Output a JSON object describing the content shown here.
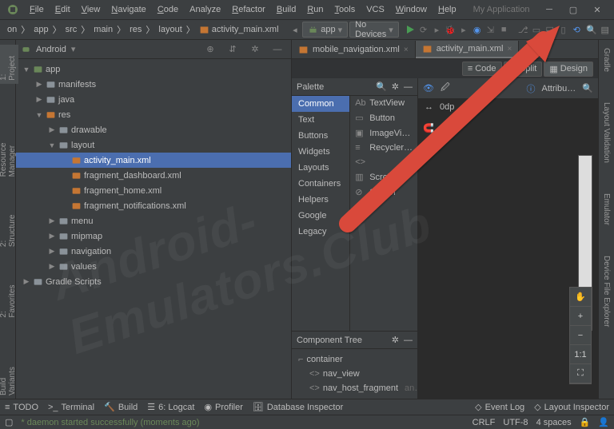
{
  "title_app": "My Application",
  "menu": [
    "File",
    "Edit",
    "View",
    "Navigate",
    "Code",
    "Analyze",
    "Refactor",
    "Build",
    "Run",
    "Tools",
    "VCS",
    "Window",
    "Help"
  ],
  "breadcrumb": [
    "on",
    "app",
    "src",
    "main",
    "res",
    "layout",
    "activity_main.xml"
  ],
  "run_dd": "app",
  "device_dd": "No Devices",
  "project_dd": "Android",
  "tree": [
    {
      "d": 0,
      "arw": "▼",
      "ic": "mod",
      "t": "app"
    },
    {
      "d": 1,
      "arw": "▶",
      "ic": "fld",
      "t": "manifests"
    },
    {
      "d": 1,
      "arw": "▶",
      "ic": "fld",
      "t": "java"
    },
    {
      "d": 1,
      "arw": "▼",
      "ic": "res",
      "t": "res"
    },
    {
      "d": 2,
      "arw": "▶",
      "ic": "fld",
      "t": "drawable"
    },
    {
      "d": 2,
      "arw": "▼",
      "ic": "fld",
      "t": "layout"
    },
    {
      "d": 3,
      "arw": "",
      "ic": "xml",
      "t": "activity_main.xml",
      "sel": true
    },
    {
      "d": 3,
      "arw": "",
      "ic": "xml",
      "t": "fragment_dashboard.xml"
    },
    {
      "d": 3,
      "arw": "",
      "ic": "xml",
      "t": "fragment_home.xml"
    },
    {
      "d": 3,
      "arw": "",
      "ic": "xml",
      "t": "fragment_notifications.xml"
    },
    {
      "d": 2,
      "arw": "▶",
      "ic": "fld",
      "t": "menu"
    },
    {
      "d": 2,
      "arw": "▶",
      "ic": "fld",
      "t": "mipmap"
    },
    {
      "d": 2,
      "arw": "▶",
      "ic": "fld",
      "t": "navigation"
    },
    {
      "d": 2,
      "arw": "▶",
      "ic": "fld",
      "t": "values"
    },
    {
      "d": 0,
      "arw": "▶",
      "ic": "grd",
      "t": "Gradle Scripts"
    }
  ],
  "tabs": [
    {
      "t": "mobile_navigation.xml",
      "active": false
    },
    {
      "t": "activity_main.xml",
      "active": true
    }
  ],
  "viewmodes": {
    "code": "Code",
    "split": "Split",
    "design": "Design"
  },
  "palette": {
    "title": "Palette",
    "cats": [
      "Common",
      "Text",
      "Buttons",
      "Widgets",
      "Layouts",
      "Containers",
      "Helpers",
      "Google",
      "Legacy"
    ],
    "items": [
      "TextView",
      "Button",
      "ImageVi…",
      "Recycler…",
      "<fragm…",
      "ScrollVi…",
      "Switch"
    ]
  },
  "comptree": {
    "title": "Component Tree",
    "items": [
      {
        "d": 0,
        "ic": "ct",
        "t": "container"
      },
      {
        "d": 1,
        "ic": "bv",
        "t": "nav_view"
      },
      {
        "d": 1,
        "ic": "fr",
        "t": "nav_host_fragment",
        "hint": "an…"
      }
    ]
  },
  "attr_title": "Attribu…",
  "canvas": {
    "dp": "0dp"
  },
  "zoom": [
    "✋",
    "+",
    "−",
    "1:1",
    "⛶"
  ],
  "gutters": {
    "left": [
      "1: Project",
      "Resource Manager",
      "2: Structure",
      "2: Favorites",
      "Build Variants"
    ],
    "right": [
      "Gradle",
      "Layout Validation",
      "Emulator",
      "Device File Explorer"
    ]
  },
  "bottom": [
    "TODO",
    "Terminal",
    "Build",
    "6: Logcat",
    "Profiler",
    "Database Inspector"
  ],
  "bottom_right": [
    "Event Log",
    "Layout Inspector"
  ],
  "status": {
    "msg": "* daemon started successfully (moments ago)",
    "enc": "CRLF",
    "utf": "UTF-8",
    "sp": "4 spaces"
  },
  "watermark": "Android-Emulators.Club"
}
